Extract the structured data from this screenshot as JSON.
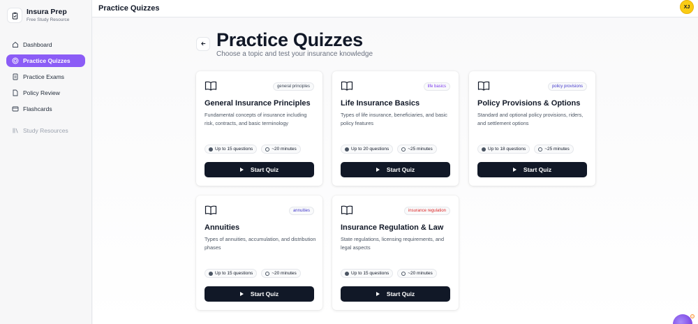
{
  "brand": {
    "title": "Insura Prep",
    "subtitle": "Free Study Resource"
  },
  "header": {
    "title": "Practice Quizzes",
    "avatar_initials": "XJ"
  },
  "sidebar": {
    "items": [
      {
        "label": "Dashboard",
        "icon": "home-icon",
        "active": false
      },
      {
        "label": "Practice Quizzes",
        "icon": "target-icon",
        "active": true
      },
      {
        "label": "Practice Exams",
        "icon": "document-icon",
        "active": false
      },
      {
        "label": "Policy Review",
        "icon": "file-icon",
        "active": false
      },
      {
        "label": "Flashcards",
        "icon": "card-icon",
        "active": false
      }
    ],
    "secondary": {
      "label": "Study Resources",
      "icon": "library-icon"
    }
  },
  "page": {
    "title": "Practice Quizzes",
    "subtitle": "Choose a topic and test your insurance knowledge"
  },
  "quizzes": [
    {
      "tag": "general principles",
      "tag_color": "#374151",
      "title": "General Insurance Principles",
      "description": "Fundamental concepts of insurance including risk, contracts, and basic terminology",
      "questions": "Up to 15 questions",
      "time": "~20 minutes",
      "button": "Start Quiz"
    },
    {
      "tag": "life basics",
      "tag_color": "#7c3aed",
      "title": "Life Insurance Basics",
      "description": "Types of life insurance, beneficiaries, and basic policy features",
      "questions": "Up to 20 questions",
      "time": "~25 minutes",
      "button": "Start Quiz"
    },
    {
      "tag": "policy provisions",
      "tag_color": "#4338ca",
      "title": "Policy Provisions & Options",
      "description": "Standard and optional policy provisions, riders, and settlement options",
      "questions": "Up to 18 questions",
      "time": "~25 minutes",
      "button": "Start Quiz"
    },
    {
      "tag": "annuities",
      "tag_color": "#4338ca",
      "title": "Annuities",
      "description": "Types of annuities, accumulation, and distribution phases",
      "questions": "Up to 15 questions",
      "time": "~20 minutes",
      "button": "Start Quiz"
    },
    {
      "tag": "insurance regulation",
      "tag_color": "#dc2626",
      "title": "Insurance Regulation & Law",
      "description": "State regulations, licensing requirements, and legal aspects",
      "questions": "Up to 15 questions",
      "time": "~20 minutes",
      "button": "Start Quiz"
    }
  ]
}
